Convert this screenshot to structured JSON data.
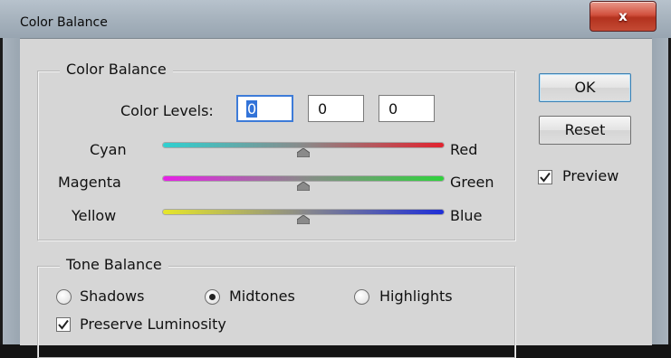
{
  "window": {
    "title": "Color Balance",
    "close_label": "x"
  },
  "color_balance": {
    "group_title": "Color Balance",
    "levels_label": "Color Levels:",
    "levels": [
      "0",
      "0",
      "0"
    ],
    "sliders": [
      {
        "left": "Cyan",
        "right": "Red",
        "value": 0
      },
      {
        "left": "Magenta",
        "right": "Green",
        "value": 0
      },
      {
        "left": "Yellow",
        "right": "Blue",
        "value": 0
      }
    ]
  },
  "tone_balance": {
    "group_title": "Tone Balance",
    "options": [
      "Shadows",
      "Midtones",
      "Highlights"
    ],
    "selected": "Midtones",
    "preserve_luminosity": {
      "label": "Preserve Luminosity",
      "checked": true
    }
  },
  "buttons": {
    "ok": "OK",
    "reset": "Reset"
  },
  "preview": {
    "label": "Preview",
    "checked": true
  },
  "colors": {
    "cyan": "#2fd0d0",
    "red": "#e2232f",
    "magenta": "#e620e6",
    "green": "#2fd23c",
    "yellow": "#e6e62a",
    "blue": "#1f2fd8",
    "selection": "#3273d8",
    "focus_border": "#3d7bd8"
  }
}
